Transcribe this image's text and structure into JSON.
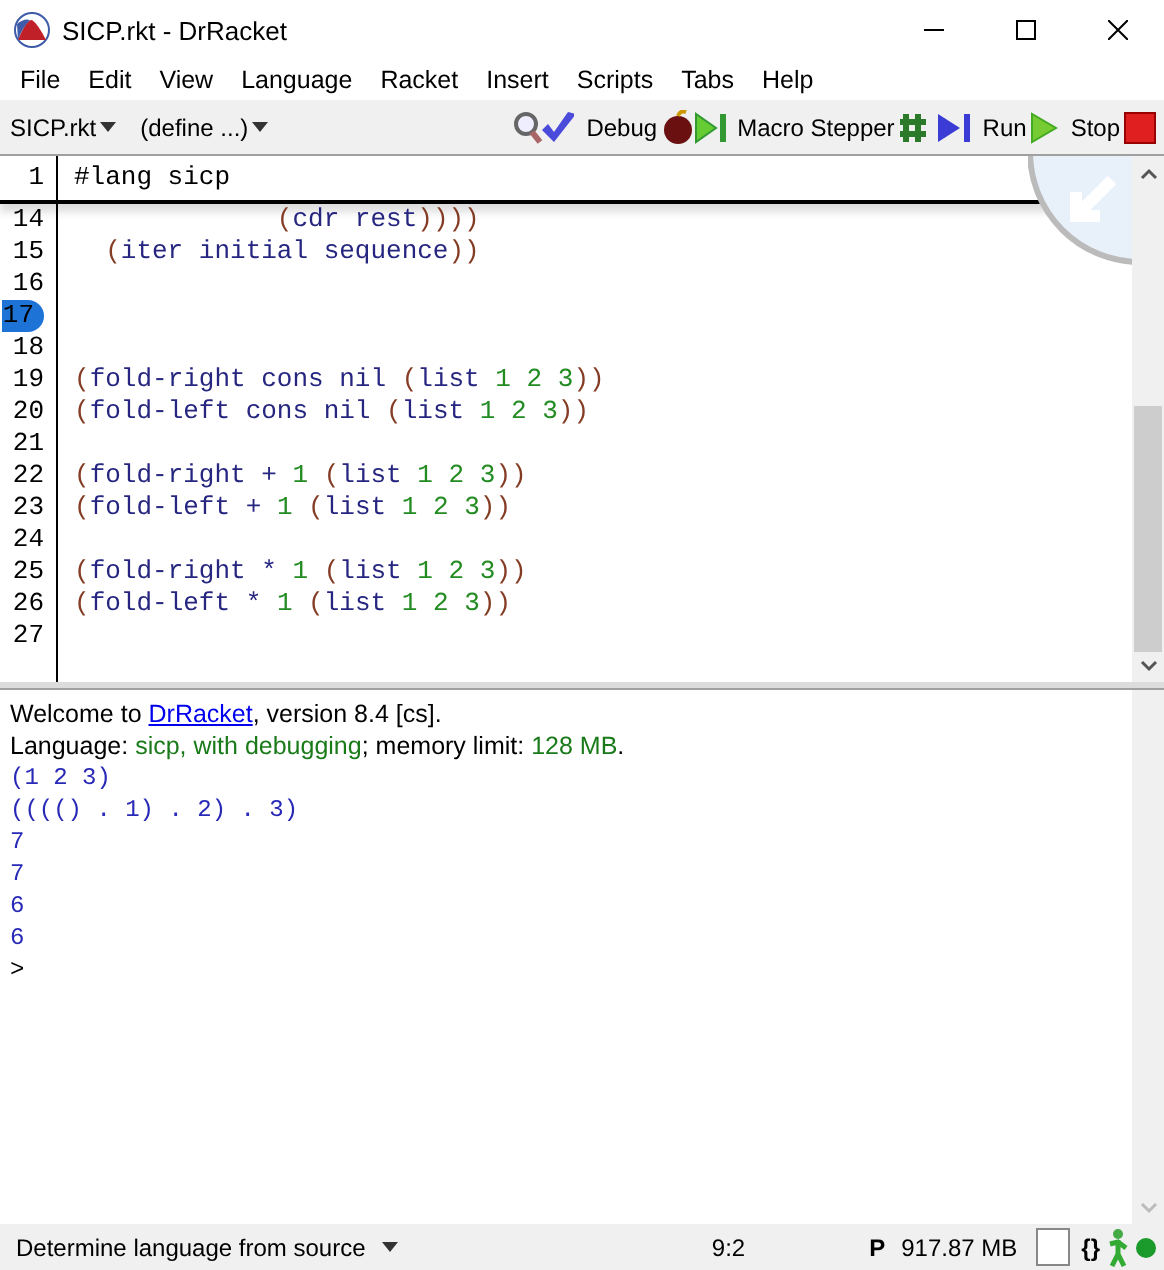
{
  "window": {
    "title": "SICP.rkt - DrRacket"
  },
  "menu": [
    "File",
    "Edit",
    "View",
    "Language",
    "Racket",
    "Insert",
    "Scripts",
    "Tabs",
    "Help"
  ],
  "toolbar": {
    "file_menu": "SICP.rkt",
    "define_menu": "(define ...)",
    "buttons": [
      {
        "kind": "check"
      },
      {
        "label": "Debug",
        "kind": "debug"
      },
      {
        "label": "Macro Stepper",
        "kind": "macro"
      },
      {
        "label": "Run",
        "kind": "run"
      },
      {
        "label": "Stop",
        "kind": "stop"
      }
    ]
  },
  "editor": {
    "header_line": {
      "number": "1",
      "segments": [
        {
          "text": "#lang sicp",
          "kind": "plain"
        }
      ]
    },
    "lines": [
      {
        "number": "14",
        "marked": false,
        "segments": [
          {
            "text": "             (",
            "kind": "paren"
          },
          {
            "text": "cdr rest",
            "kind": "symbol"
          },
          {
            "text": "))))",
            "kind": "paren"
          }
        ]
      },
      {
        "number": "15",
        "marked": false,
        "segments": [
          {
            "text": "  (",
            "kind": "paren"
          },
          {
            "text": "iter initial sequence",
            "kind": "symbol"
          },
          {
            "text": "))",
            "kind": "paren"
          }
        ]
      },
      {
        "number": "16",
        "marked": false
      },
      {
        "number": "17",
        "marked": true
      },
      {
        "number": "18",
        "marked": false
      },
      {
        "number": "19",
        "marked": false,
        "segments": [
          {
            "text": "(",
            "kind": "paren"
          },
          {
            "text": "fold-right cons nil ",
            "kind": "symbol"
          },
          {
            "text": "(",
            "kind": "paren"
          },
          {
            "text": "list ",
            "kind": "symbol"
          },
          {
            "text": "1 2 3",
            "kind": "constant"
          },
          {
            "text": "))",
            "kind": "paren"
          }
        ]
      },
      {
        "number": "20",
        "marked": false,
        "segments": [
          {
            "text": "(",
            "kind": "paren"
          },
          {
            "text": "fold-left cons nil ",
            "kind": "symbol"
          },
          {
            "text": "(",
            "kind": "paren"
          },
          {
            "text": "list ",
            "kind": "symbol"
          },
          {
            "text": "1 2 3",
            "kind": "constant"
          },
          {
            "text": "))",
            "kind": "paren"
          }
        ]
      },
      {
        "number": "21",
        "marked": false
      },
      {
        "number": "22",
        "marked": false,
        "segments": [
          {
            "text": "(",
            "kind": "paren"
          },
          {
            "text": "fold-right + ",
            "kind": "symbol"
          },
          {
            "text": "1",
            "kind": "constant"
          },
          {
            "text": " (",
            "kind": "paren"
          },
          {
            "text": "list ",
            "kind": "symbol"
          },
          {
            "text": "1 2 3",
            "kind": "constant"
          },
          {
            "text": "))",
            "kind": "paren"
          }
        ]
      },
      {
        "number": "23",
        "marked": false,
        "segments": [
          {
            "text": "(",
            "kind": "paren"
          },
          {
            "text": "fold-left + ",
            "kind": "symbol"
          },
          {
            "text": "1",
            "kind": "constant"
          },
          {
            "text": " (",
            "kind": "paren"
          },
          {
            "text": "list ",
            "kind": "symbol"
          },
          {
            "text": "1 2 3",
            "kind": "constant"
          },
          {
            "text": "))",
            "kind": "paren"
          }
        ]
      },
      {
        "number": "24",
        "marked": false
      },
      {
        "number": "25",
        "marked": false,
        "segments": [
          {
            "text": "(",
            "kind": "paren"
          },
          {
            "text": "fold-right * ",
            "kind": "symbol"
          },
          {
            "text": "1",
            "kind": "constant"
          },
          {
            "text": " (",
            "kind": "paren"
          },
          {
            "text": "list ",
            "kind": "symbol"
          },
          {
            "text": "1 2 3",
            "kind": "constant"
          },
          {
            "text": "))",
            "kind": "paren"
          }
        ]
      },
      {
        "number": "26",
        "marked": false,
        "segments": [
          {
            "text": "(",
            "kind": "paren"
          },
          {
            "text": "fold-left * ",
            "kind": "symbol"
          },
          {
            "text": "1",
            "kind": "constant"
          },
          {
            "text": " (",
            "kind": "paren"
          },
          {
            "text": "list ",
            "kind": "symbol"
          },
          {
            "text": "1 2 3",
            "kind": "constant"
          },
          {
            "text": "))",
            "kind": "paren"
          }
        ]
      },
      {
        "number": "27",
        "marked": false
      }
    ]
  },
  "repl": {
    "welcome": {
      "before": "Welcome to ",
      "link": "DrRacket",
      "after": ", version 8.4 [cs]."
    },
    "language": [
      {
        "text": "Language: ",
        "kind": "plain"
      },
      {
        "text": "sicp, with debugging",
        "kind": "value"
      },
      {
        "text": "; memory limit: ",
        "kind": "plain"
      },
      {
        "text": "128 MB",
        "kind": "value"
      },
      {
        "text": ".",
        "kind": "plain"
      }
    ],
    "outputs": [
      "(1 2 3)",
      "(((() . 1) . 2) . 3)",
      "7",
      "7",
      "6",
      "6"
    ],
    "prompt": ">"
  },
  "status_bar": {
    "language_menu": "Determine language from source",
    "position": "9:2",
    "mode": "P",
    "memory": "917.87 MB",
    "braces": "{}"
  }
}
